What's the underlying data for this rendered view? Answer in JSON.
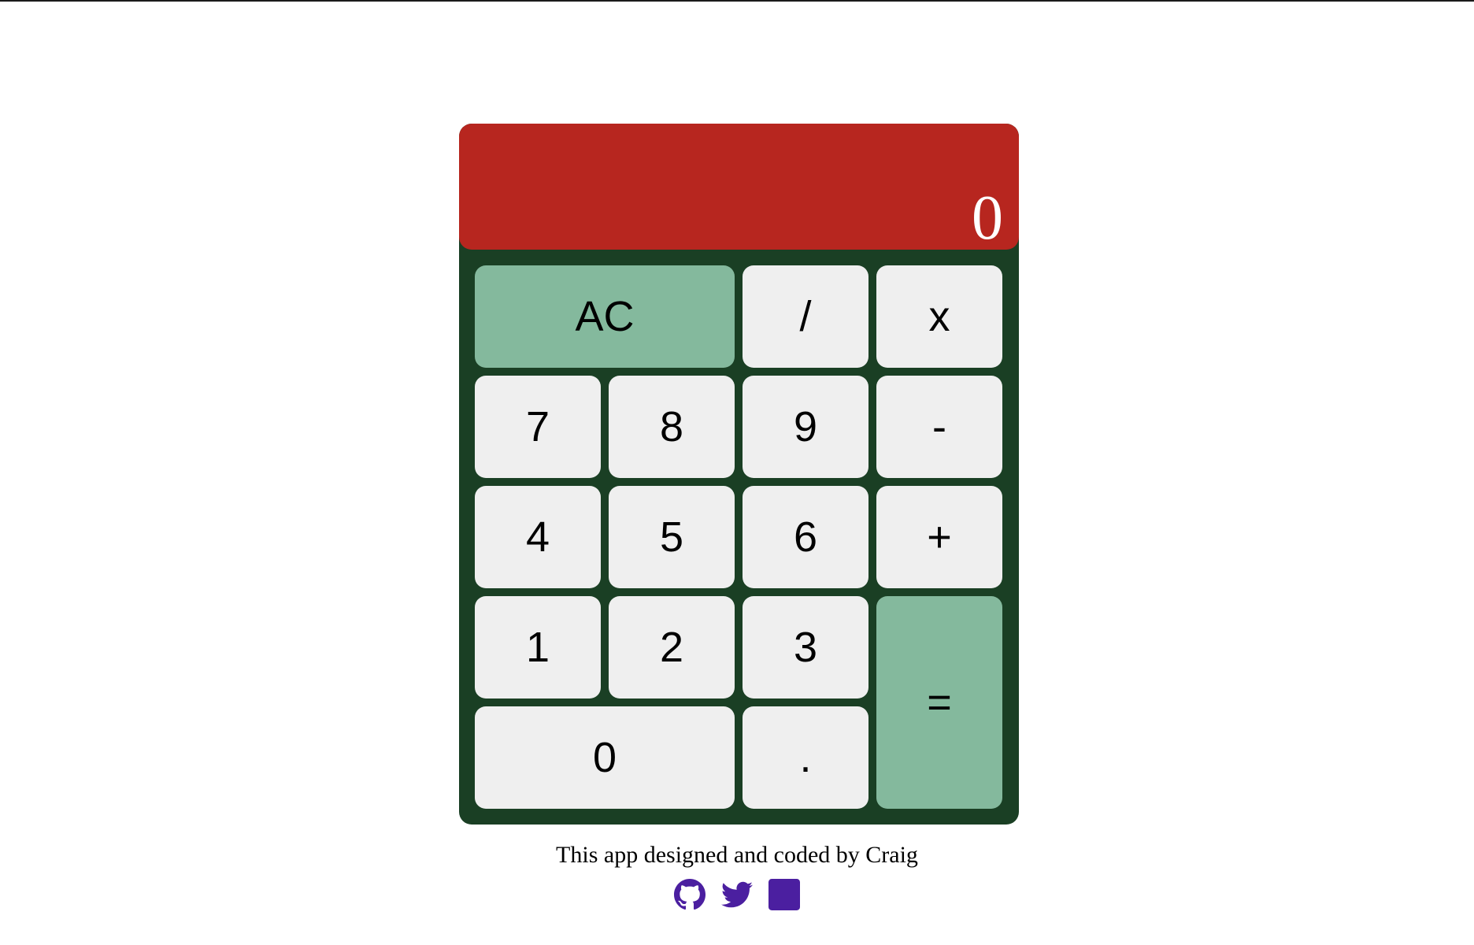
{
  "display": {
    "value": "0"
  },
  "keys": {
    "clear": "AC",
    "divide": "/",
    "multiply": "x",
    "seven": "7",
    "eight": "8",
    "nine": "9",
    "subtract": "-",
    "four": "4",
    "five": "5",
    "six": "6",
    "add": "+",
    "one": "1",
    "two": "2",
    "three": "3",
    "equals": "=",
    "zero": "0",
    "decimal": "."
  },
  "footer": {
    "credit": "This app designed and coded by Craig",
    "links": [
      {
        "icon": "github-icon"
      },
      {
        "icon": "twitter-icon"
      },
      {
        "icon": "linkedin-icon"
      }
    ],
    "link_color": "#4b1fa0"
  },
  "colors": {
    "display_bg": "#b7261f",
    "body_bg": "#1a3f24",
    "key_bg": "#efefef",
    "accent_key_bg": "#84b99d"
  }
}
